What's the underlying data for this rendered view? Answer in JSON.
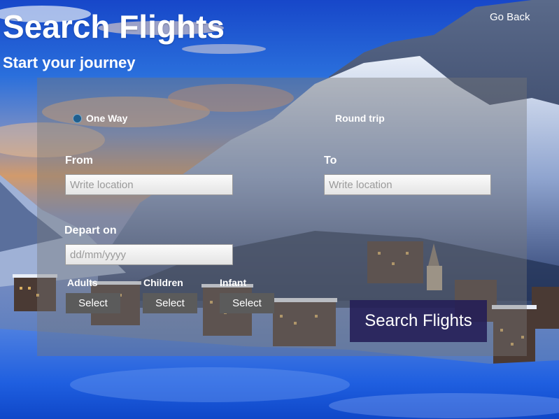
{
  "header": {
    "title": "Search Flights",
    "subtitle": "Start your journey",
    "go_back": "Go Back"
  },
  "trip_type": {
    "one_way": "One Way",
    "round_trip": "Round trip",
    "selected": "One Way"
  },
  "from": {
    "label": "From",
    "placeholder": "Write location",
    "value": ""
  },
  "to": {
    "label": "To",
    "placeholder": "Write location",
    "value": ""
  },
  "depart": {
    "label": "Depart on",
    "placeholder": "dd/mm/yyyy",
    "value": ""
  },
  "passengers": {
    "adults": {
      "label": "Adults",
      "select": "Select"
    },
    "children": {
      "label": "Children",
      "select": "Select"
    },
    "infant": {
      "label": "Infant",
      "select": "Select"
    }
  },
  "search_button": "Search Flights",
  "colors": {
    "panel": "#767676",
    "select_button": "#5b5b5b",
    "search_button": "#231c55",
    "radio": "#1f5f8f"
  },
  "icons": {
    "radio_selected": "radio-selected-icon"
  }
}
